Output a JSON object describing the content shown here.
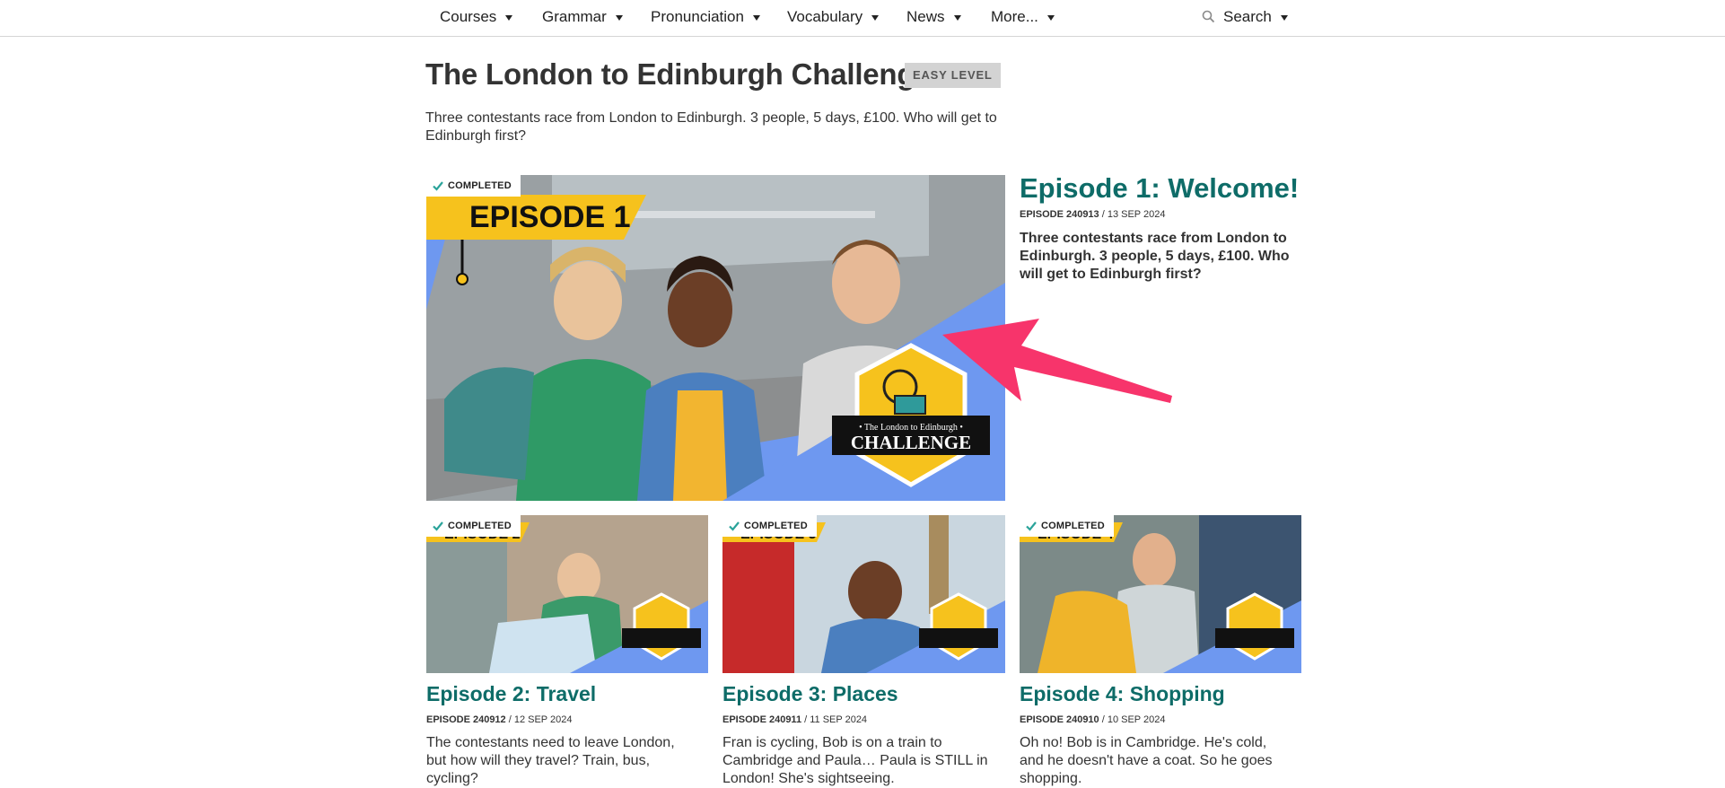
{
  "nav": {
    "items": [
      "Courses",
      "Grammar",
      "Pronunciation",
      "Vocabulary",
      "News",
      "More..."
    ],
    "search_label": "Search"
  },
  "header": {
    "title": "The London to Edinburgh Challenge",
    "level_badge": "EASY LEVEL",
    "intro": "Three contestants race from London to Edinburgh. 3 people, 5 days, £100. Who will get to Edinburgh first?"
  },
  "featured": {
    "completed_label": "COMPLETED",
    "image_episode_label": "EPISODE 1",
    "badge_small_text": "• The London to Edinburgh •",
    "badge_big_text": "CHALLENGE",
    "title": "Episode 1: Welcome!",
    "code": "EPISODE 240913",
    "date": "13 SEP 2024",
    "description": "Three contestants race from London to Edinburgh. 3 people, 5 days, £100. Who will get to Edinburgh first?"
  },
  "episodes": [
    {
      "completed_label": "COMPLETED",
      "image_episode_label": "EPISODE 2",
      "title": "Episode 2: Travel",
      "code": "EPISODE 240912",
      "date": "12 SEP 2024",
      "description": "The contestants need to leave London, but how will they travel? Train, bus, cycling?"
    },
    {
      "completed_label": "COMPLETED",
      "image_episode_label": "EPISODE 3",
      "title": "Episode 3: Places",
      "code": "EPISODE 240911",
      "date": "11 SEP 2024",
      "description": "Fran is cycling, Bob is on a train to Cambridge and Paula… Paula is STILL in London! She's sightseeing."
    },
    {
      "completed_label": "COMPLETED",
      "image_episode_label": "EPISODE 4",
      "title": "Episode 4: Shopping",
      "code": "EPISODE 240910",
      "date": "10 SEP 2024",
      "description": "Oh no! Bob is in Cambridge. He's cold, and he doesn't have a coat. So he goes shopping."
    }
  ],
  "colors": {
    "accent_teal": "#0e6c68",
    "banner_yellow": "#f6c21d",
    "image_blue": "#6e98f0",
    "arrow_pink": "#f7346b"
  },
  "icons": [
    "search-icon",
    "caret-down-icon",
    "check-icon",
    "arrow-annotation"
  ]
}
